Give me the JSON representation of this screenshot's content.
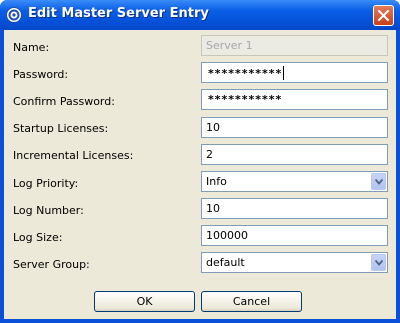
{
  "window": {
    "title": "Edit Master Server Entry",
    "icons": {
      "app": "server-app-icon",
      "close": "close-icon"
    },
    "colors": {
      "titlebar": "#0a5fe6",
      "close_button": "#c9401c",
      "client_bg": "#ece9d8"
    }
  },
  "form": {
    "name": {
      "label": "Name:",
      "value": "Server 1",
      "disabled": true
    },
    "password": {
      "label": "Password:",
      "value": "***********"
    },
    "confirm_password": {
      "label": "Confirm Password:",
      "value": "***********"
    },
    "startup_licenses": {
      "label": "Startup Licenses:",
      "value": "10"
    },
    "incremental_licenses": {
      "label": "Incremental Licenses:",
      "value": "2"
    },
    "log_priority": {
      "label": "Log Priority:",
      "value": "Info",
      "icon": "chevron-down-icon"
    },
    "log_number": {
      "label": "Log Number:",
      "value": "10"
    },
    "log_size": {
      "label": "Log Size:",
      "value": "100000"
    },
    "server_group": {
      "label": "Server Group:",
      "value": "default",
      "icon": "chevron-down-icon"
    }
  },
  "buttons": {
    "ok": "OK",
    "cancel": "Cancel"
  }
}
